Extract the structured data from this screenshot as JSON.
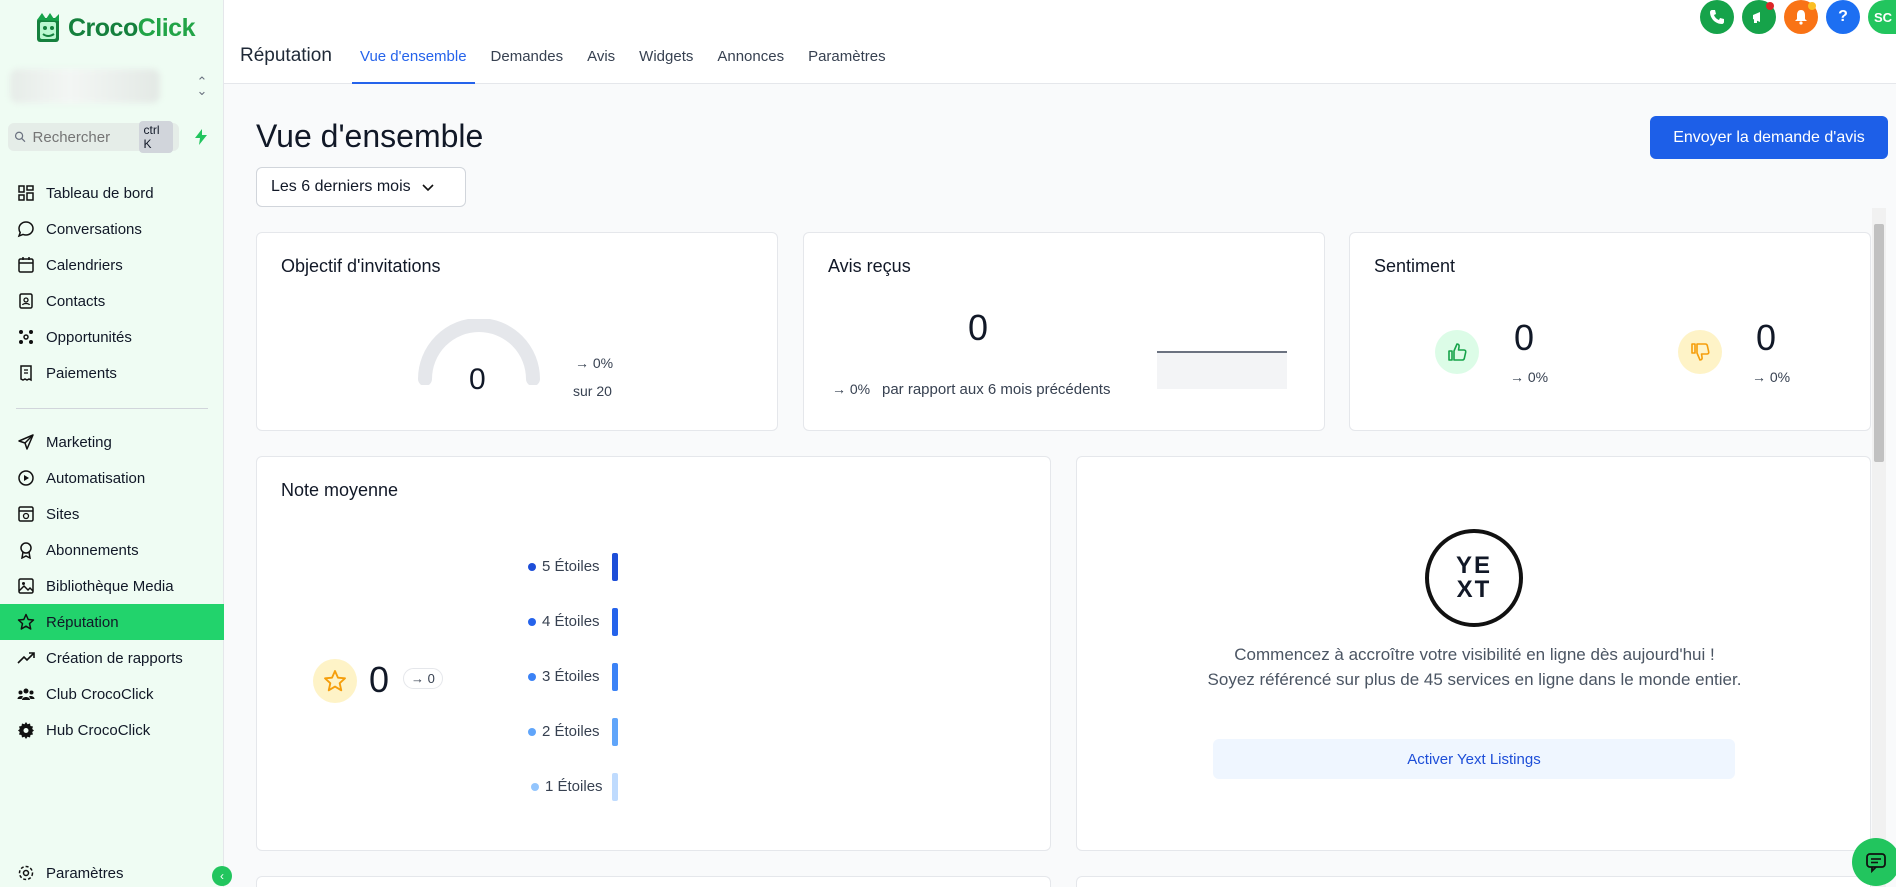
{
  "brand": {
    "name_part1": "Croco",
    "name_part2": "Click"
  },
  "search": {
    "placeholder": "Rechercher",
    "shortcut": "ctrl K"
  },
  "sidebar": {
    "items": [
      {
        "label": "Tableau de bord",
        "icon": "grid-icon"
      },
      {
        "label": "Conversations",
        "icon": "chat-icon"
      },
      {
        "label": "Calendriers",
        "icon": "calendar-icon"
      },
      {
        "label": "Contacts",
        "icon": "contacts-icon"
      },
      {
        "label": "Opportunités",
        "icon": "opportunities-icon"
      },
      {
        "label": "Paiements",
        "icon": "payments-icon"
      }
    ],
    "items2": [
      {
        "label": "Marketing",
        "icon": "send-icon"
      },
      {
        "label": "Automatisation",
        "icon": "automation-icon"
      },
      {
        "label": "Sites",
        "icon": "sites-icon"
      },
      {
        "label": "Abonnements",
        "icon": "badge-icon"
      },
      {
        "label": "Bibliothèque Media",
        "icon": "image-icon"
      },
      {
        "label": "Réputation",
        "icon": "star-icon"
      },
      {
        "label": "Création de rapports",
        "icon": "trend-icon"
      },
      {
        "label": "Club CrocoClick",
        "icon": "users-icon"
      },
      {
        "label": "Hub CrocoClick",
        "icon": "cog-icon"
      }
    ],
    "settings_label": "Paramètres"
  },
  "topbar": {
    "title": "Réputation",
    "tabs": [
      "Vue d'ensemble",
      "Demandes",
      "Avis",
      "Widgets",
      "Annonces",
      "Paramètres"
    ],
    "avatar_initials": "SC",
    "help_label": "?"
  },
  "main": {
    "title": "Vue d'ensemble",
    "send_button": "Envoyer la demande d'avis",
    "range": "Les 6 derniers mois"
  },
  "invitations": {
    "title": "Objectif d'invitations",
    "value": "0",
    "delta": "→ 0%",
    "goal": "sur 20"
  },
  "reviews": {
    "title": "Avis reçus",
    "value": "0",
    "delta": "→ 0%",
    "compare": "par rapport aux 6 mois précédents"
  },
  "sentiment": {
    "title": "Sentiment",
    "positive": "0",
    "positive_delta": "→ 0%",
    "negative": "0",
    "negative_delta": "→ 0%"
  },
  "rating": {
    "title": "Note moyenne",
    "value": "0",
    "delta": "→ 0",
    "rows": [
      {
        "label": "5 Étoiles",
        "color": "#1d4ed8"
      },
      {
        "label": "4 Étoiles",
        "color": "#2563eb"
      },
      {
        "label": "3 Étoiles",
        "color": "#3b82f6"
      },
      {
        "label": "2 Étoiles",
        "color": "#60a5fa"
      },
      {
        "label": "1 Étoiles",
        "color": "#93c5fd"
      }
    ]
  },
  "yext": {
    "line1": "Commencez à accroître votre visibilité en ligne dès aujourd'hui !",
    "line2": "Soyez référencé sur plus de 45 services en ligne dans le monde entier.",
    "button": "Activer Yext Listings",
    "logo_top": "YE",
    "logo_bottom": "XT"
  }
}
